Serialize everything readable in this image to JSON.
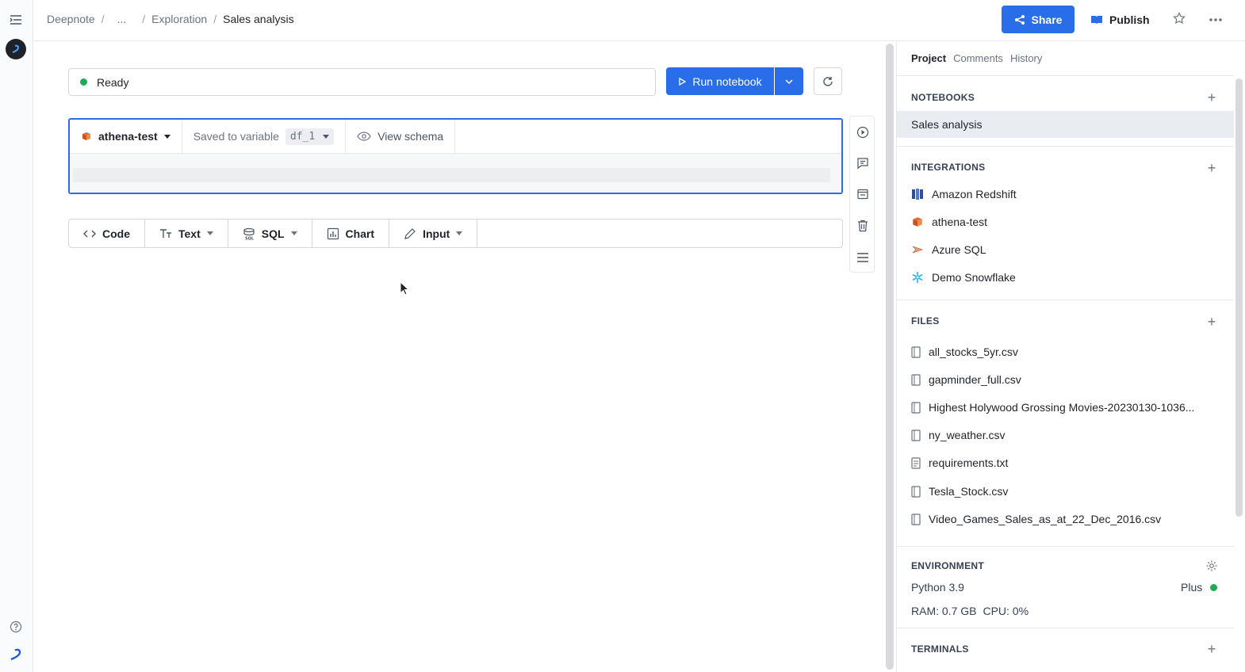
{
  "breadcrumb": {
    "root": "Deepnote",
    "ellipsis": "...",
    "folder": "Exploration",
    "current": "Sales analysis"
  },
  "header": {
    "share_label": "Share",
    "publish_label": "Publish"
  },
  "status": {
    "text": "Ready"
  },
  "toolbar": {
    "run_label": "Run notebook"
  },
  "sql_cell": {
    "integration": "athena-test",
    "saved_label": "Saved to variable",
    "variable": "df_1",
    "schema_label": "View schema"
  },
  "add_block": {
    "code": "Code",
    "text": "Text",
    "sql": "SQL",
    "chart": "Chart",
    "input": "Input"
  },
  "panel": {
    "tabs": [
      "Project",
      "Comments",
      "History"
    ],
    "notebooks_title": "NOTEBOOKS",
    "notebooks": [
      "Sales analysis"
    ],
    "integrations_title": "INTEGRATIONS",
    "integrations": [
      {
        "name": "Amazon Redshift",
        "icon": "redshift-icon"
      },
      {
        "name": "athena-test",
        "icon": "athena-icon"
      },
      {
        "name": "Azure SQL",
        "icon": "azure-sql-icon"
      },
      {
        "name": "Demo Snowflake",
        "icon": "snowflake-icon"
      }
    ],
    "files_title": "FILES",
    "files": [
      "all_stocks_5yr.csv",
      "gapminder_full.csv",
      "Highest Holywood Grossing Movies-20230130-1036...",
      "ny_weather.csv",
      "requirements.txt",
      "Tesla_Stock.csv",
      "Video_Games_Sales_as_at_22_Dec_2016.csv"
    ],
    "environment_title": "ENVIRONMENT",
    "python": "Python 3.9",
    "plan": "Plus",
    "ram": "RAM: 0.7 GB",
    "cpu": "CPU: 0%",
    "terminals_title": "TERMINALS"
  },
  "colors": {
    "accent": "#2a6de8",
    "status_ok": "#1fab55"
  }
}
